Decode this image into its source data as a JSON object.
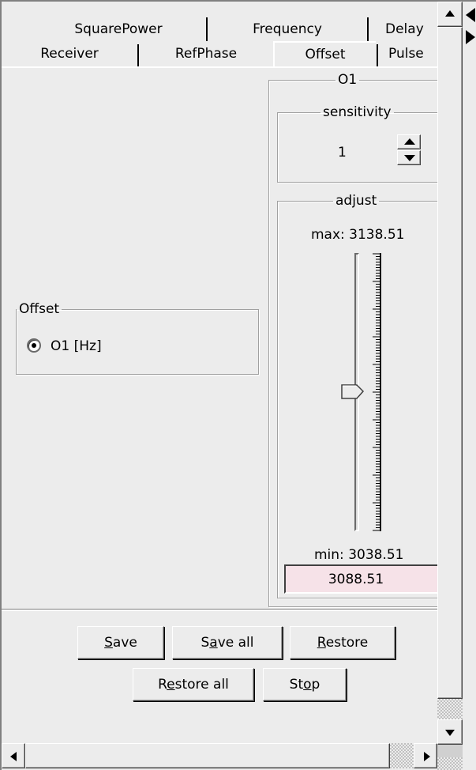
{
  "tabs": {
    "row1": [
      "SquarePower",
      "Frequency",
      "Delay"
    ],
    "row2": [
      "Receiver",
      "RefPhase",
      "Offset",
      "Pulse"
    ],
    "active": "Offset"
  },
  "offset_group": {
    "title": "Offset",
    "radio_label": "O1 [Hz]",
    "radio_selected": true
  },
  "o1_group": {
    "title": "O1",
    "sensitivity": {
      "title": "sensitivity",
      "value": "1"
    },
    "adjust": {
      "title": "adjust",
      "max_label": "max:",
      "max_value": "3138.51",
      "min_label": "min:",
      "min_value": "3038.51",
      "current_value": "3088.51",
      "slider_fraction": 0.5,
      "field_color": "#f6e2e8"
    }
  },
  "buttons": {
    "save": {
      "pre": "",
      "mn": "S",
      "post": "ave"
    },
    "save_all": {
      "pre": "S",
      "mn": "a",
      "post": "ve all"
    },
    "restore": {
      "pre": "",
      "mn": "R",
      "post": "estore"
    },
    "restore_all": {
      "pre": "R",
      "mn": "e",
      "post": "store all"
    },
    "stop": {
      "pre": "St",
      "mn": "o",
      "post": "p"
    }
  },
  "icons": {
    "scroll_up": "arrow-up-icon",
    "scroll_down": "arrow-down-icon",
    "scroll_left": "arrow-left-icon",
    "scroll_right": "arrow-right-icon",
    "spin_up": "spin-up-icon",
    "spin_down": "spin-down-icon"
  }
}
